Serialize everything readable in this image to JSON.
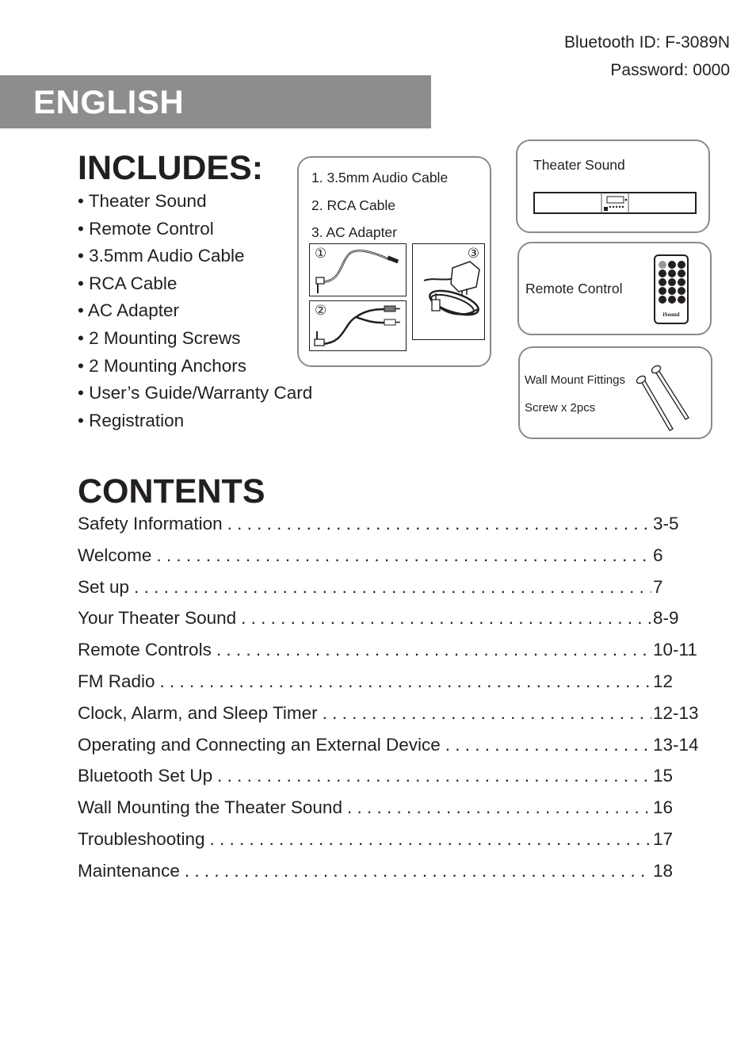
{
  "bluetooth": {
    "id_line": "Bluetooth ID: F-3089N",
    "password_line": "Password: 0000"
  },
  "language_banner": "ENGLISH",
  "includes": {
    "title": "INCLUDES:",
    "items": [
      "Theater Sound",
      "Remote Control",
      "3.5mm Audio Cable",
      "RCA Cable",
      "AC Adapter",
      "2 Mounting Screws",
      "2 Mounting Anchors",
      "User’s Guide/Warranty Card",
      "Registration"
    ]
  },
  "accessories_card": {
    "lines": [
      "1. 3.5mm Audio Cable",
      "2. RCA Cable",
      "3. AC Adapter"
    ],
    "markers": [
      "①",
      "②",
      "③"
    ]
  },
  "theater_sound_card": {
    "label": "Theater Sound"
  },
  "remote_card": {
    "label": "Remote Control",
    "brand": "iSound"
  },
  "wall_mount_card": {
    "line1": "Wall Mount Fittings",
    "line2": "Screw x 2pcs"
  },
  "contents": {
    "title": "CONTENTS",
    "entries": [
      {
        "title": "Safety Information",
        "pages": "3-5"
      },
      {
        "title": "Welcome",
        "pages": "6"
      },
      {
        "title": "Set up",
        "pages": "7"
      },
      {
        "title": "Your Theater Sound",
        "pages": "8-9"
      },
      {
        "title": "Remote Controls",
        "pages": "10-11"
      },
      {
        "title": "FM Radio",
        "pages": "12"
      },
      {
        "title": "Clock, Alarm, and Sleep Timer",
        "pages": "12-13"
      },
      {
        "title": "Operating and Connecting an External Device",
        "pages": "13-14"
      },
      {
        "title": "Bluetooth Set Up",
        "pages": "15"
      },
      {
        "title": "Wall Mounting the Theater Sound",
        "pages": "16"
      },
      {
        "title": "Troubleshooting",
        "pages": "17"
      },
      {
        "title": "Maintenance",
        "pages": "18"
      }
    ]
  }
}
